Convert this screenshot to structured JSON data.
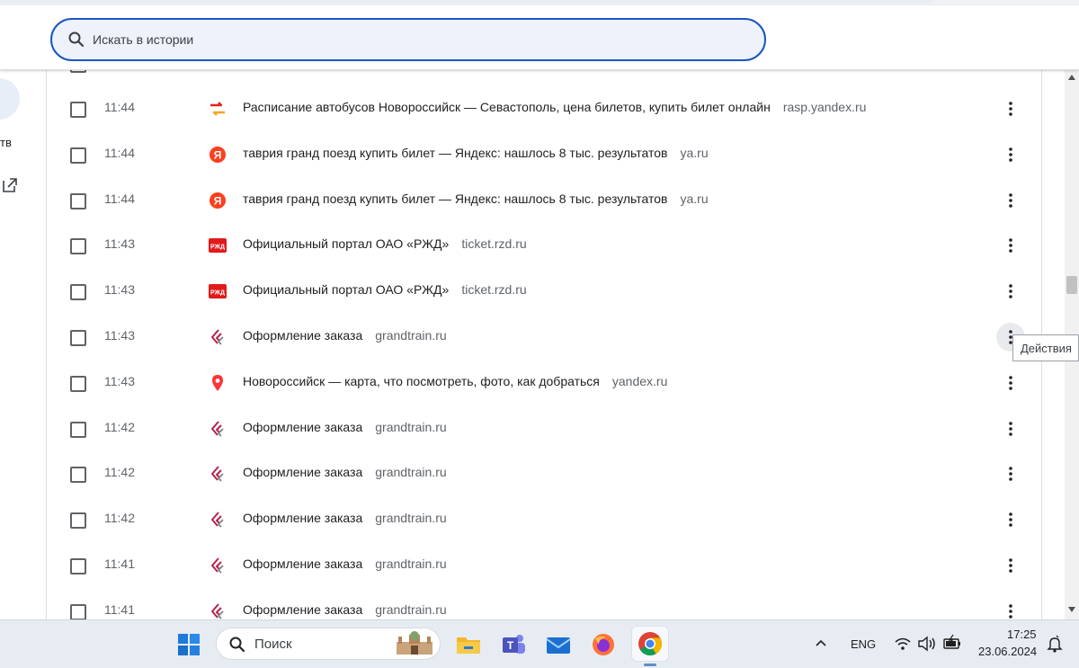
{
  "search": {
    "placeholder": "Искать в истории"
  },
  "leftnav": {
    "partial_label": "тв"
  },
  "tooltip": {
    "text": "Действия"
  },
  "history_rows": [
    {
      "time": "11:44",
      "title": "Расписание автобусов Новороссийск — Севастополь, цена билетов, купить билет онлайн",
      "domain": "rasp.yandex.ru",
      "icon": "rasp-icon"
    },
    {
      "time": "11:44",
      "title": "таврия гранд поезд купить билет — Яндекс: нашлось 8 тыс. результатов",
      "domain": "ya.ru",
      "icon": "yandex-icon"
    },
    {
      "time": "11:44",
      "title": "таврия гранд поезд купить билет — Яндекс: нашлось 8 тыс. результатов",
      "domain": "ya.ru",
      "icon": "yandex-icon"
    },
    {
      "time": "11:43",
      "title": "Официальный портал ОАО «РЖД»",
      "domain": "ticket.rzd.ru",
      "icon": "rzd-icon"
    },
    {
      "time": "11:43",
      "title": "Официальный портал ОАО «РЖД»",
      "domain": "ticket.rzd.ru",
      "icon": "rzd-icon"
    },
    {
      "time": "11:43",
      "title": "Оформление заказа",
      "domain": "grandtrain.ru",
      "icon": "grandtrain-icon"
    },
    {
      "time": "11:43",
      "title": "Новороссийск — карта, что посмотреть, фото, как добраться",
      "domain": "yandex.ru",
      "icon": "map-pin-icon"
    },
    {
      "time": "11:42",
      "title": "Оформление заказа",
      "domain": "grandtrain.ru",
      "icon": "grandtrain-icon"
    },
    {
      "time": "11:42",
      "title": "Оформление заказа",
      "domain": "grandtrain.ru",
      "icon": "grandtrain-icon"
    },
    {
      "time": "11:42",
      "title": "Оформление заказа",
      "domain": "grandtrain.ru",
      "icon": "grandtrain-icon"
    },
    {
      "time": "11:41",
      "title": "Оформление заказа",
      "domain": "grandtrain.ru",
      "icon": "grandtrain-icon"
    },
    {
      "time": "11:41",
      "title": "Оформление заказа",
      "domain": "grandtrain.ru",
      "icon": "grandtrain-icon"
    }
  ],
  "taskbar": {
    "search_label": "Поиск",
    "language": "ENG",
    "time": "17:25",
    "date": "23.06.2024",
    "apps": [
      "windows-start-icon",
      "file-explorer-icon",
      "teams-icon",
      "mail-icon",
      "firefox-icon",
      "chrome-icon"
    ]
  }
}
